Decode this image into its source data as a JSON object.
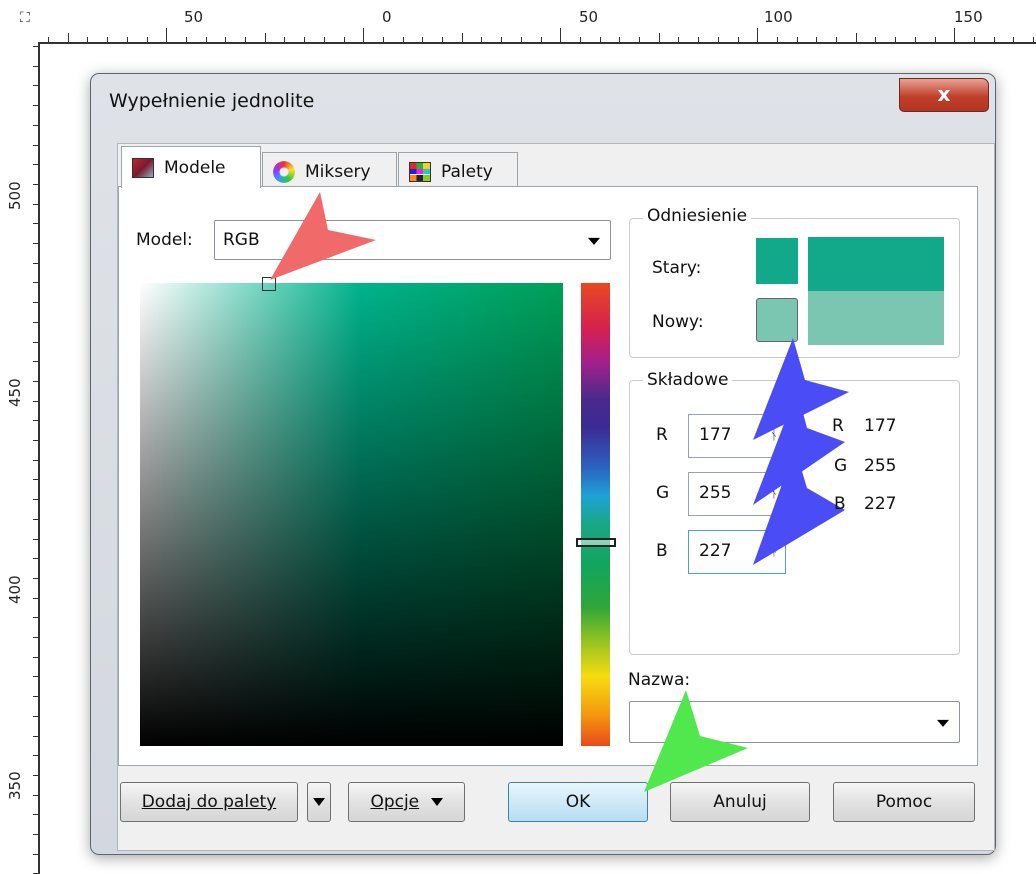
{
  "ruler": {
    "h_labels": [
      "50",
      "0",
      "50",
      "100",
      "150"
    ],
    "v_labels": [
      "500",
      "450",
      "400",
      "350"
    ]
  },
  "dialog": {
    "title": "Wypełnienie jednolite",
    "close_label": "x",
    "tabs": [
      {
        "label": "Modele"
      },
      {
        "label": "Miksery"
      },
      {
        "label": "Palety"
      }
    ],
    "model": {
      "label": "Model:",
      "value": "RGB"
    },
    "reference": {
      "title": "Odniesienie",
      "old_label": "Stary:",
      "new_label": "Nowy:",
      "old_color": "#12a98a",
      "new_color": "#7ac6b0"
    },
    "components": {
      "title": "Składowe",
      "rows": [
        {
          "label": "R",
          "value": "177"
        },
        {
          "label": "G",
          "value": "255"
        },
        {
          "label": "B",
          "value": "227"
        }
      ],
      "readouts": [
        {
          "label": "R",
          "value": "177"
        },
        {
          "label": "G",
          "value": "255"
        },
        {
          "label": "B",
          "value": "227"
        }
      ]
    },
    "name": {
      "label": "Nazwa:",
      "value": ""
    },
    "buttons": {
      "add_to_palette": "Dodaj do palety",
      "options": "Opcje",
      "ok": "OK",
      "cancel": "Anuluj",
      "help": "Pomoc"
    }
  },
  "colors": {
    "annotation_red": "#f06a6a",
    "annotation_blue": "#4a4df5",
    "annotation_green": "#50e84c"
  }
}
